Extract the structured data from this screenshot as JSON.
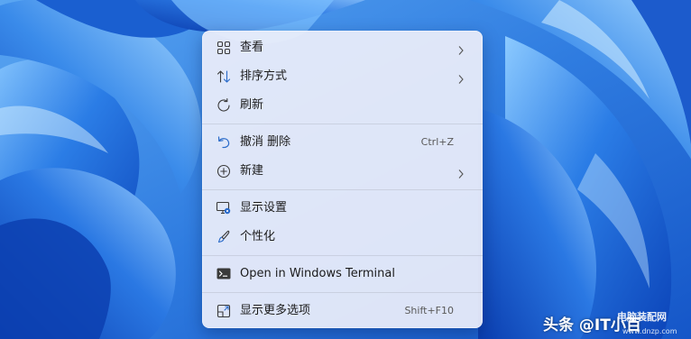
{
  "menu": {
    "items": [
      {
        "label": "查看",
        "icon": "grid-view-icon",
        "has_submenu": true
      },
      {
        "label": "排序方式",
        "icon": "sort-arrows-icon",
        "has_submenu": true
      },
      {
        "label": "刷新",
        "icon": "refresh-icon",
        "has_submenu": false
      },
      {
        "label": "撤消 删除",
        "icon": "undo-icon",
        "shortcut": "Ctrl+Z"
      },
      {
        "label": "新建",
        "icon": "new-plus-icon",
        "has_submenu": true
      },
      {
        "label": "显示设置",
        "icon": "display-settings-icon"
      },
      {
        "label": "个性化",
        "icon": "brush-icon"
      },
      {
        "label": "Open in Windows Terminal",
        "icon": "terminal-icon"
      },
      {
        "label": "显示更多选项",
        "icon": "more-options-icon",
        "shortcut": "Shift+F10"
      }
    ]
  },
  "watermark": {
    "text": "头条 @IT小百",
    "logo_text_main": "电脑装配网",
    "logo_text_sub": "www.dnzp.com"
  },
  "colors": {
    "wallpaper_dark": "#0a3fb5",
    "wallpaper_light": "#6fb8ff",
    "menu_bg": "#eceefa",
    "icon_blue": "#2a6bc9"
  }
}
